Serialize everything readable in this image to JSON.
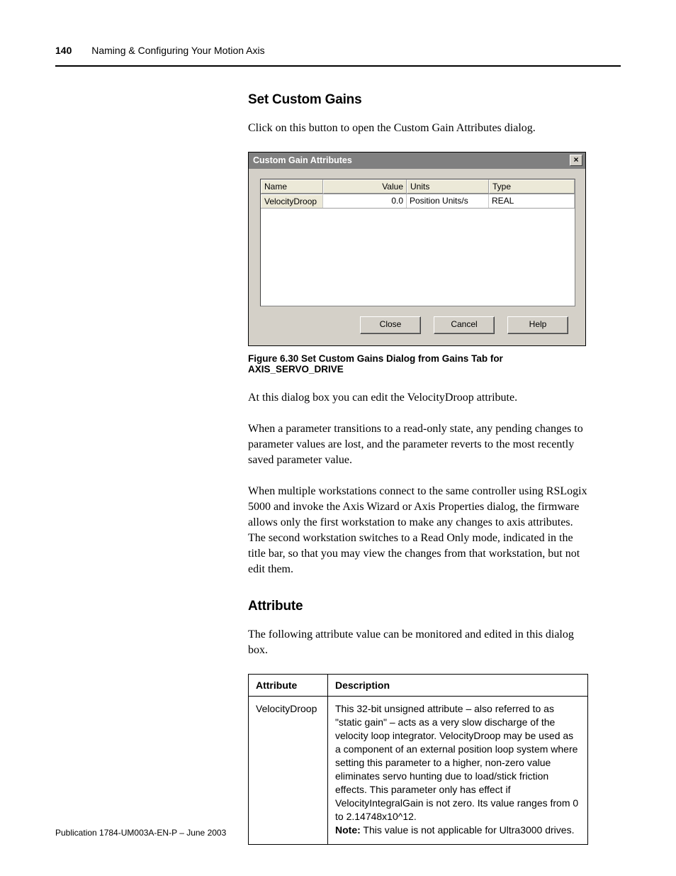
{
  "header": {
    "page_number": "140",
    "chapter": "Naming & Configuring Your Motion Axis"
  },
  "section": {
    "h2": "Set Custom Gains",
    "intro": "Click on this button to open the Custom Gain Attributes dialog."
  },
  "dialog": {
    "title": "Custom Gain Attributes",
    "grid_headers": {
      "name": "Name",
      "value": "Value",
      "units": "Units",
      "type": "Type"
    },
    "row": {
      "name": "VelocityDroop",
      "value": "0.0",
      "units": "Position Units/s",
      "type": "REAL"
    },
    "buttons": {
      "close": "Close",
      "cancel": "Cancel",
      "help": "Help"
    }
  },
  "figure_caption": "Figure 6.30 Set Custom Gains Dialog from Gains Tab for AXIS_SERVO_DRIVE",
  "paragraphs": {
    "p1": "At this dialog box you can edit the VelocityDroop attribute.",
    "p2": "When a parameter transitions to a read-only state, any pending changes to parameter values are lost, and the parameter reverts to the most recently saved parameter value.",
    "p3": "When multiple workstations connect to the same controller using RSLogix 5000 and invoke the Axis Wizard or Axis Properties dialog, the firmware allows only the first workstation to make any changes to axis attributes. The second workstation switches to a Read Only mode, indicated in the title bar, so that you may view the changes from that workstation, but not edit them."
  },
  "attribute_section": {
    "heading": "Attribute",
    "intro": "The following attribute value can be monitored and edited in this dialog box.",
    "table": {
      "headers": {
        "attr": "Attribute",
        "desc": "Description"
      },
      "row": {
        "attr": "VelocityDroop",
        "desc_main": "This 32-bit unsigned attribute – also referred to as \"static gain\" – acts as a very slow discharge of the velocity loop integrator. VelocityDroop may be used as a component of an external position loop system where setting this parameter to a higher, non-zero value eliminates servo hunting due to load/stick friction effects. This parameter only has effect if VelocityIntegralGain is not zero. Its value ranges from 0 to 2.14748x10^12.",
        "note_label": "Note:",
        "note_text": " This value is not applicable for Ultra3000 drives."
      }
    }
  },
  "footer": "Publication 1784-UM003A-EN-P – June 2003"
}
